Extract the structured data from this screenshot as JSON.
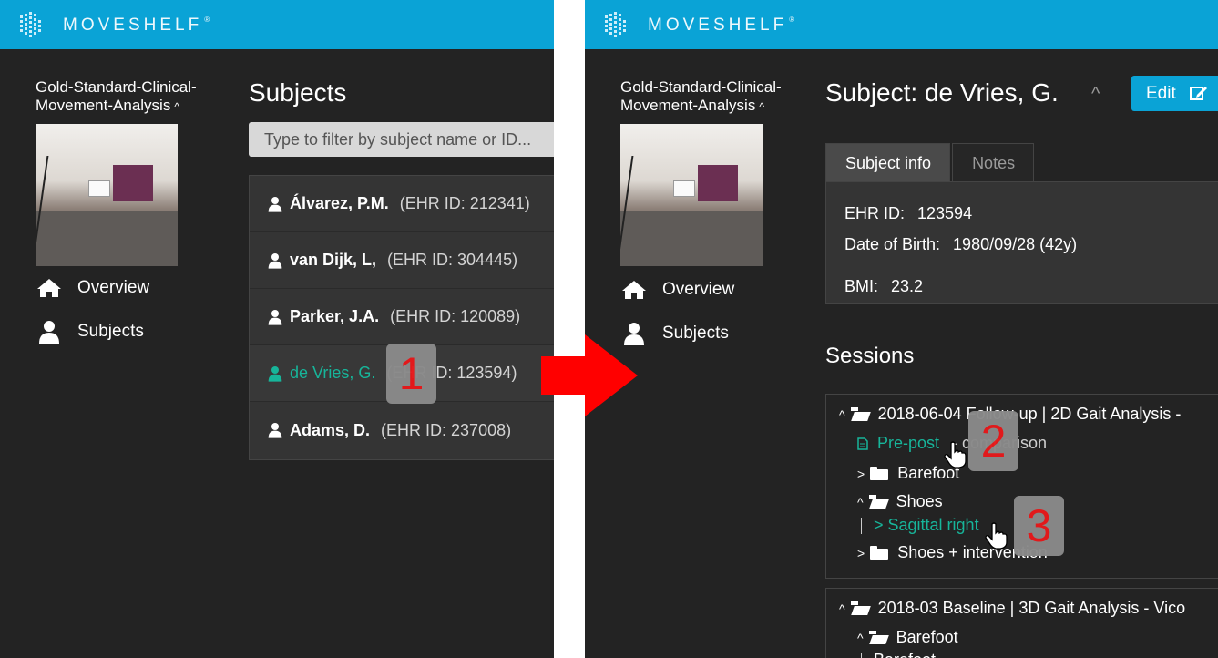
{
  "brand": {
    "name": "MOVESHELF",
    "mark": "®"
  },
  "left": {
    "project": {
      "line1": "Gold-Standard-Clinical-",
      "line2": "Movement-Analysis",
      "chevron": "^"
    },
    "nav": [
      {
        "label": "Overview",
        "icon": "home-icon"
      },
      {
        "label": "Subjects",
        "icon": "user-icon"
      }
    ],
    "heading": "Subjects",
    "filter_placeholder": "Type to filter by subject name or ID...",
    "subjects": [
      {
        "name": "Álvarez, P.M.",
        "id": "(EHR ID: 212341)"
      },
      {
        "name": "van Dijk, L,",
        "id": "(EHR ID: 304445)"
      },
      {
        "name": "Parker, J.A.",
        "id": "(EHR ID: 120089)"
      },
      {
        "name": "de Vries, G.",
        "id": "(EHR ID: 123594)"
      },
      {
        "name": "Adams, D.",
        "id": "(EHR ID: 237008)"
      }
    ],
    "step_badge": "1"
  },
  "right": {
    "project": {
      "line1": "Gold-Standard-Clinical-",
      "line2": "Movement-Analysis",
      "chevron": "^"
    },
    "nav": [
      {
        "label": "Overview",
        "icon": "home-icon"
      },
      {
        "label": "Subjects",
        "icon": "user-icon"
      }
    ],
    "title": "Subject: de Vries, G.",
    "collapse": "^",
    "edit_label": "Edit",
    "tabs": [
      "Subject info",
      "Notes"
    ],
    "info": {
      "ehr_label": "EHR ID:",
      "ehr_value": "123594",
      "dob_label": "Date of Birth:",
      "dob_value": "1980/09/28 (42y)",
      "bmi_label": "BMI:",
      "bmi_value": "23.2"
    },
    "sessions_heading": "Sessions",
    "session1": {
      "title": "2018-06-04 Follow-up | 2D Gait Analysis -",
      "report": "Pre-post",
      "report_suffix": "- comparison",
      "folders": [
        "Barefoot",
        "Shoes",
        "Shoes + intervention"
      ],
      "clip": "> Sagittal right"
    },
    "session2": {
      "title": "2018-03 Baseline | 3D Gait Analysis - Vico",
      "folder": "Barefoot",
      "clip": "Barefoot"
    },
    "step_badges": [
      "2",
      "3"
    ]
  },
  "colors": {
    "brand": "#0aa3d6",
    "accent": "#17b59a",
    "badge_text": "#e8191b",
    "arrow": "#ff0000"
  }
}
